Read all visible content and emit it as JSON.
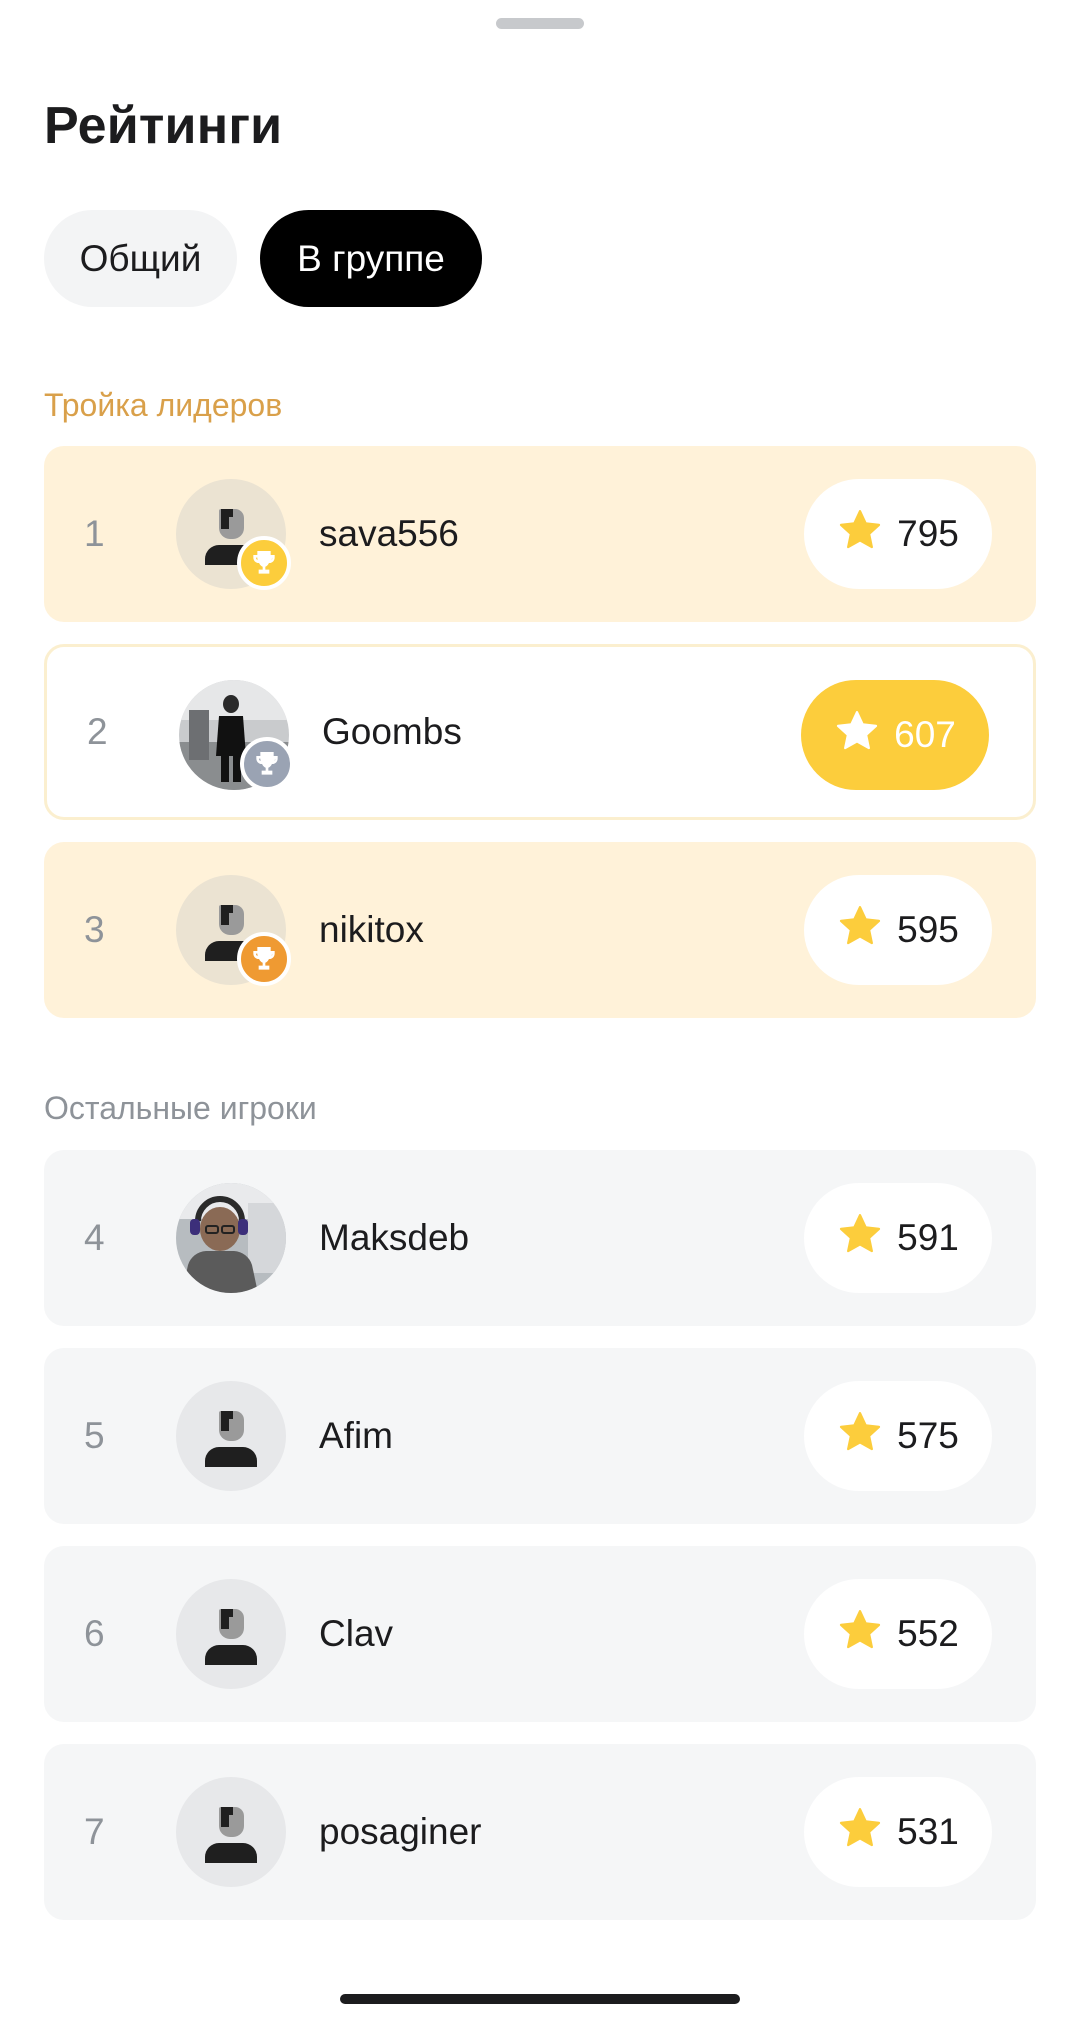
{
  "title": "Рейтинги",
  "tabs": [
    {
      "label": "Общий",
      "active": false
    },
    {
      "label": "В группе",
      "active": true
    }
  ],
  "leaders_section": {
    "label": "Тройка лидеров",
    "color": "#d9a04a"
  },
  "others_section": {
    "label": "Остальные игроки",
    "color": "#8e9399"
  },
  "leaders": [
    {
      "rank": "1",
      "name": "sava556",
      "score": "795",
      "avatar": "default-avatar",
      "trophy": "gold",
      "highlight": false
    },
    {
      "rank": "2",
      "name": "Goombs",
      "score": "607",
      "avatar": "photo-avatar",
      "trophy": "silver",
      "highlight": true
    },
    {
      "rank": "3",
      "name": "nikitox",
      "score": "595",
      "avatar": "default-avatar",
      "trophy": "bronze",
      "highlight": false
    }
  ],
  "others": [
    {
      "rank": "4",
      "name": "Maksdeb",
      "score": "591",
      "avatar": "photo-avatar"
    },
    {
      "rank": "5",
      "name": "Afim",
      "score": "575",
      "avatar": "default-avatar"
    },
    {
      "rank": "6",
      "name": "Clav",
      "score": "552",
      "avatar": "default-avatar"
    },
    {
      "rank": "7",
      "name": "posaginer",
      "score": "531",
      "avatar": "default-avatar"
    }
  ],
  "colors": {
    "star": "#fccd3c",
    "gold": "#fccd3c",
    "silver": "#9aa3b3",
    "bronze": "#ef9a32",
    "leader_bg": "#fff2d9",
    "other_bg": "#f5f6f7"
  }
}
